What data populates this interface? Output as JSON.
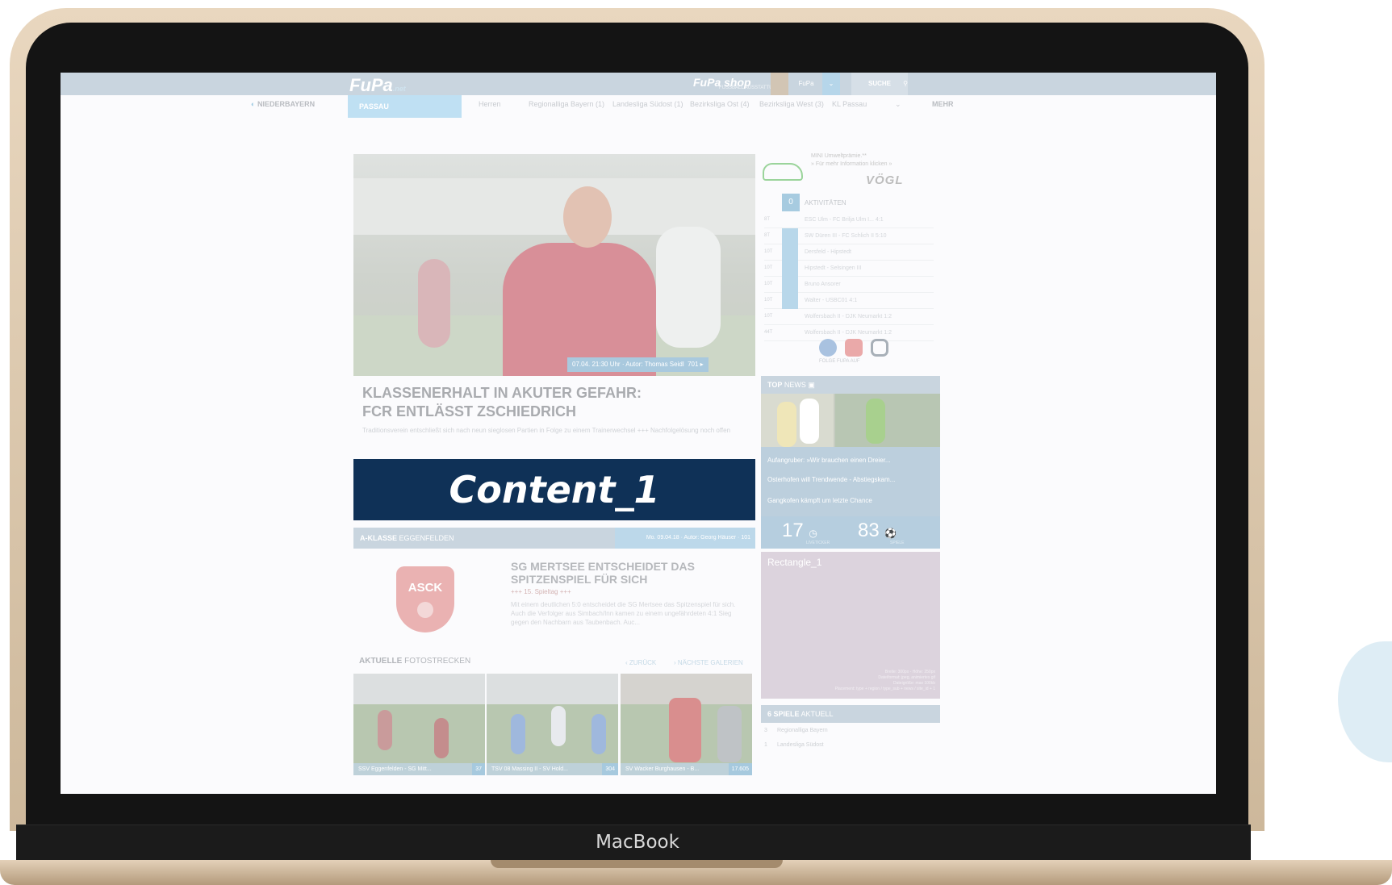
{
  "device": {
    "brand": "MacBook"
  },
  "site": {
    "logo": "FuPa",
    "logo_suffix": ".net",
    "shop": "FuPa shop",
    "shop_sub": "FUSSBALL AUSSTATTUNG",
    "user_label": "FuPa",
    "search_label": "SUCHE"
  },
  "nav": {
    "region": "NIEDERBAYERN",
    "active": "PASSAU",
    "category": "Herren",
    "leagues": [
      "Regionalliga Bayern (1)",
      "Landesliga Südost (1)",
      "Bezirksliga Ost (4)",
      "Bezirksliga West (3)",
      "KL Passau"
    ],
    "more": "MEHR"
  },
  "hero": {
    "meta": "07.04. 21:30 Uhr · Autor: Thomas Seidl",
    "views": "701",
    "headline_1": "KLASSENERHALT IN AKUTER GEFAHR:",
    "headline_2": "FCR ENTLÄSST ZSCHIEDRICH",
    "lead": "Traditionsverein entschließt sich nach neun sieglosen Partien in Folge zu einem Trainerwechsel +++ Nachfolgelösung noch offen"
  },
  "content_banner": "Content_1",
  "section": {
    "label_bold": "A-KLASSE",
    "label_rest": "EGGENFELDEN",
    "meta": "Mo. 09.04.18 · Autor: Georg Häuser · 101"
  },
  "article2": {
    "crest": "ASCK",
    "title": "SG MERTSEE ENTSCHEIDET DAS SPITZENSPIEL FÜR SICH",
    "subtitle": "+++ 15. Spieltag +++",
    "text": "Mit einem deutlichen 5:0 entscheidet die SG Mertsee das Spitzenspiel für sich. Auch die Verfolger aus Simbach/Inn kamen zu einem ungefährdeten 4:1 Sieg gegen den Nachbarn aus Taubenbach. Auc..."
  },
  "gallery": {
    "head_bold": "AKTUELLE",
    "head_rest": "FOTOSTRECKEN",
    "back": "ZURÜCK",
    "next": "NÄCHSTE GALERIEN",
    "items": [
      {
        "caption": "SSV Eggenfelden - SG Mitt...",
        "count": "37"
      },
      {
        "caption": "TSV 08 Massing II - SV Hold...",
        "count": "304"
      },
      {
        "caption": "SV Wacker Burghausen - B...",
        "count": "17.605"
      }
    ]
  },
  "ad": {
    "line1": "MINI Umweltprämie.**",
    "line2": "» Für mehr Information klicken »",
    "brand": "VÖGL"
  },
  "activities": {
    "count": "0",
    "title": "AKTIVITÄTEN",
    "rows": [
      {
        "time": "8T",
        "text": "ESC Ulm - FC Brilja Ulm I... 4:1"
      },
      {
        "time": "8T",
        "text": "SW Düren III - FC Schlich II 5:10"
      },
      {
        "time": "10T",
        "text": "Dersfeld - Hipstedt"
      },
      {
        "time": "10T",
        "text": "Hipstedt - Selsingen III"
      },
      {
        "time": "10T",
        "text": "Bruno Ansorer"
      },
      {
        "time": "10T",
        "text": "Walter - USBC01 4:1"
      },
      {
        "time": "10T",
        "text": "Wolfersbach II - DJK Neumarkt 1:2"
      },
      {
        "time": "44T",
        "text": "Wolfersbach II - DJK Neumarkt 1:2"
      }
    ],
    "follow": "FOLGE FUPA AUF"
  },
  "top_news": {
    "head_bold": "TOP",
    "head_rest": "NEWS",
    "items": [
      "Aufangruber: »Wir brauchen einen Dreier...",
      "Osterhofen will Trendwende - Abstiegskam...",
      "Gangkofen kämpft um letzte Chance"
    ],
    "stat1_value": "17",
    "stat1_label": "LIVETICKER",
    "stat2_value": "83",
    "stat2_label": "SPIELE"
  },
  "rectangle": {
    "label": "Rectangle_1",
    "spec_1": "Breite: 300px - Höhe: 250px",
    "spec_2": "Dateiformat: jpeg, animiertes gif",
    "spec_3": "Dateigröße: max 100kb",
    "spec_4": "Placement: type + region / type_sub + news / site_id + 1"
  },
  "games": {
    "head_bold": "6 SPIELE",
    "head_rest": "AKTUELL",
    "rows": [
      {
        "count": "3",
        "league": "Regionalliga Bayern"
      },
      {
        "count": "1",
        "league": "Landesliga Südost"
      }
    ]
  },
  "colors": {
    "banner": "#0f3157",
    "accent": "#a7cbe0",
    "bezel": "#141414",
    "gold": "#e3cfb5"
  }
}
